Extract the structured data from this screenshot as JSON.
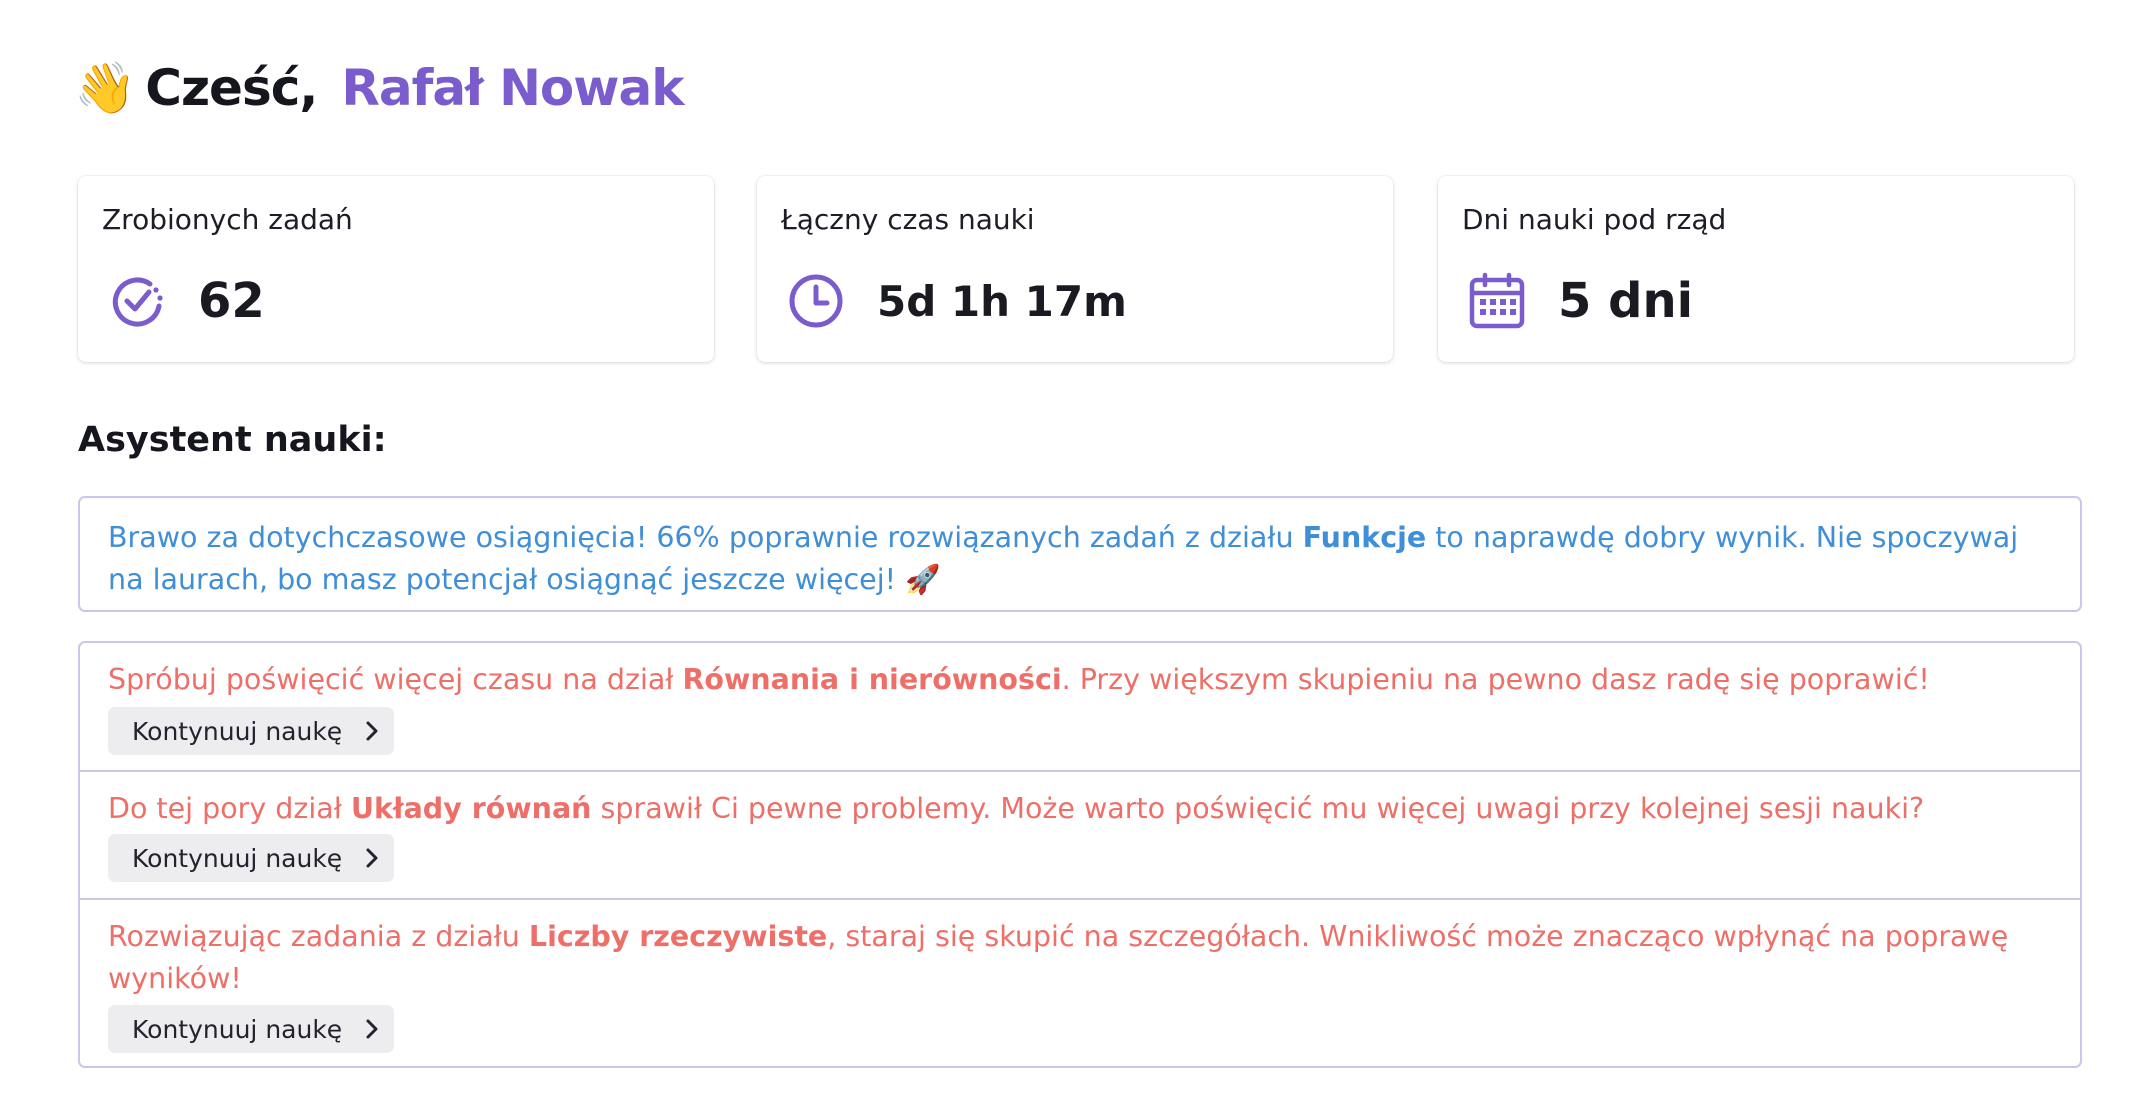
{
  "greeting": {
    "emoji": "👋",
    "hello": "Cześć,",
    "name": "Rafał Nowak"
  },
  "stats": [
    {
      "label": "Zrobionych zadań",
      "value": "62",
      "icon": "task-check-icon"
    },
    {
      "label": "Łączny czas nauki",
      "value": "5d 1h 17m",
      "icon": "clock-icon"
    },
    {
      "label": "Dni nauki pod rząd",
      "value": "5 dni",
      "icon": "calendar-icon"
    }
  ],
  "assistant": {
    "title": "Asystent nauki:",
    "praise": {
      "before": "Brawo za dotychczasowe osiągnięcia! 66% poprawnie rozwiązanych zadań z działu ",
      "topic": "Funkcje",
      "after": " to naprawdę dobry wynik. Nie spoczywaj na laurach, bo masz potencjał osiągnąć jeszcze więcej! 🚀"
    },
    "tips": [
      {
        "before": "Spróbuj poświęcić więcej czasu na dział ",
        "topic": "Równania i nierówności",
        "after": ". Przy większym skupieniu na pewno dasz radę się poprawić!",
        "button": "Kontynuuj naukę"
      },
      {
        "before": "Do tej pory dział ",
        "topic": "Układy równań",
        "after": " sprawił Ci pewne problemy. Może warto poświęcić mu więcej uwagi przy kolejnej sesji nauki?",
        "button": "Kontynuuj naukę"
      },
      {
        "before": "Rozwiązując zadania z działu ",
        "topic": "Liczby rzeczywiste",
        "after": ", staraj się skupić na szczegółach. Wnikliwość może znacząco wpłynąć na poprawę wyników!",
        "button": "Kontynuuj naukę"
      }
    ]
  },
  "colors": {
    "accent": "#7b5ccc",
    "praise_text": "#3f8ed8",
    "tip_text": "#ee6f68",
    "border": "#c9c7ee",
    "button_bg": "#ededf0"
  }
}
